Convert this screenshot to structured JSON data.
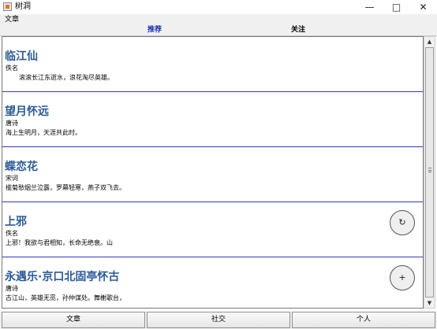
{
  "window": {
    "title": "树洞"
  },
  "menu": {
    "label": "文章"
  },
  "tabs": [
    {
      "label": "推荐"
    },
    {
      "label": "关注"
    }
  ],
  "cards": [
    {
      "title": "临江仙",
      "author": "佚名",
      "text": "滚滚长江东逝水，浪花淘尽英雄。"
    },
    {
      "title": "望月怀远",
      "author": "唐诗",
      "text": "海上生明月，天涯共此时。"
    },
    {
      "title": "蝶恋花",
      "author": "宋词",
      "text": "槛菊愁烟兰泣露，罗幕轻寒，燕子双飞去。"
    },
    {
      "title": "上邪",
      "author": "佚名",
      "text": "上邪！我欲与君相知，长命无绝衰。山"
    },
    {
      "title": "永遇乐·京口北固亭怀古",
      "author": "唐诗",
      "text": "古江山，英雄无觅，孙仲谋处。舞榭歌台，"
    }
  ],
  "floating_buttons": [
    {
      "icon": "refresh-icon",
      "glyph": "↻"
    },
    {
      "icon": "add-icon",
      "glyph": "+"
    }
  ],
  "bottom_nav": [
    {
      "label": "文章"
    },
    {
      "label": "社交"
    },
    {
      "label": "个人"
    }
  ],
  "colors": {
    "title": "#2b5a97",
    "active_tab": "#1a2fb3",
    "card_divider": "#2d3ac8"
  }
}
